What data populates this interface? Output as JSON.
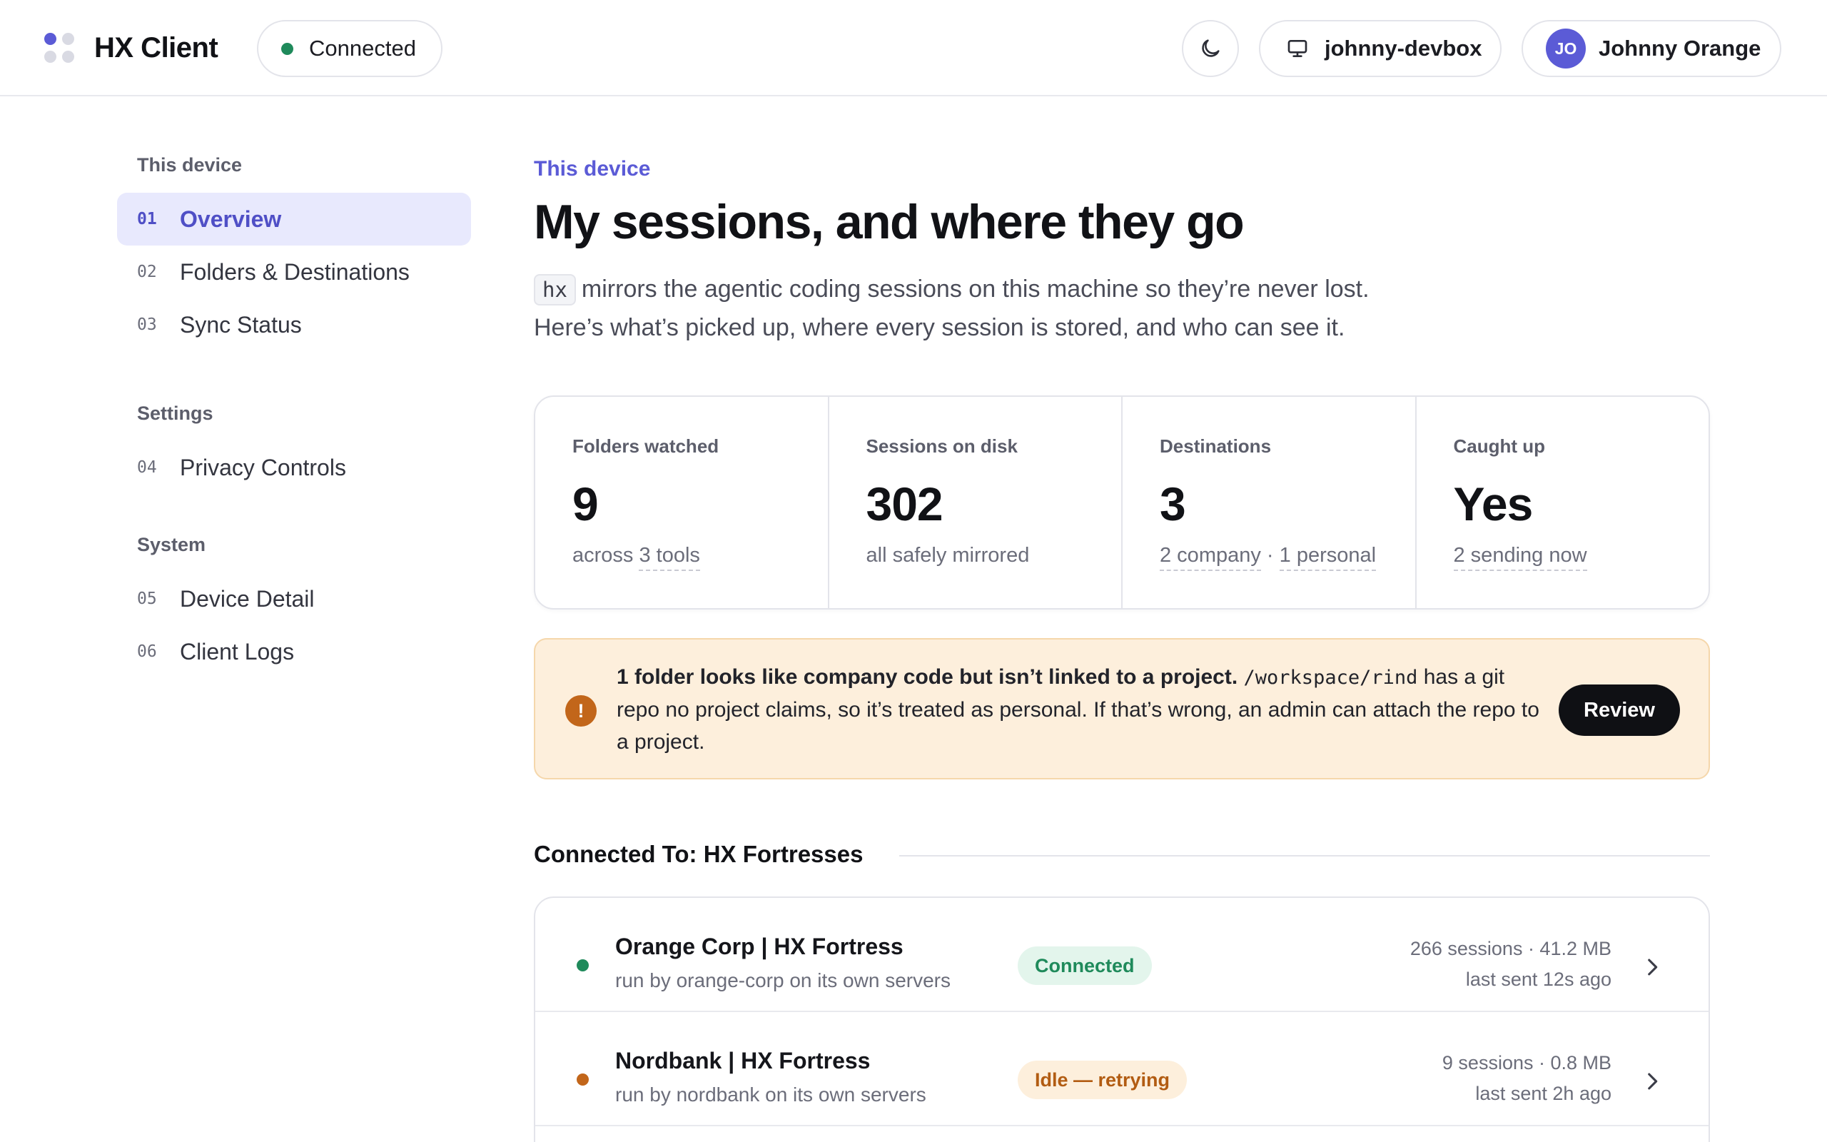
{
  "app": {
    "title": "HX Client",
    "status": "Connected",
    "device": "johnny-devbox",
    "user_initials": "JO",
    "user_name": "Johnny Orange"
  },
  "sidebar": {
    "groups": [
      {
        "label": "This device",
        "items": [
          {
            "num": "01",
            "label": "Overview"
          },
          {
            "num": "02",
            "label": "Folders & Destinations"
          },
          {
            "num": "03",
            "label": "Sync Status"
          }
        ]
      },
      {
        "label": "Settings",
        "items": [
          {
            "num": "04",
            "label": "Privacy Controls"
          }
        ]
      },
      {
        "label": "System",
        "items": [
          {
            "num": "05",
            "label": "Device Detail"
          },
          {
            "num": "06",
            "label": "Client Logs"
          }
        ]
      }
    ]
  },
  "main": {
    "eyebrow": "This device",
    "title": "My sessions, and where they go",
    "intro_code": "hx",
    "intro_line1": "mirrors the agentic coding sessions on this machine so they’re never lost.",
    "intro_line2": "Here’s what’s picked up, where every session is stored, and who can see it.",
    "stats": [
      {
        "label": "Folders watched",
        "value": "9",
        "sub_prefix": "across ",
        "sub_a": "3 tools",
        "sub_sep": "",
        "sub_b": ""
      },
      {
        "label": "Sessions on disk",
        "value": "302",
        "sub_prefix": "all safely mirrored",
        "sub_a": "",
        "sub_sep": "",
        "sub_b": ""
      },
      {
        "label": "Destinations",
        "value": "3",
        "sub_prefix": "",
        "sub_a": "2 company",
        "sub_sep": " · ",
        "sub_b": "1 personal"
      },
      {
        "label": "Caught up",
        "value": "Yes",
        "sub_prefix": "",
        "sub_a": "2 sending now",
        "sub_sep": "",
        "sub_b": ""
      }
    ],
    "alert": {
      "bold": "1 folder looks like company code but isn’t linked to a project.",
      "path": "/workspace/rind",
      "rest": "has a git repo no project claims, so it’s treated as personal. If that’s wrong, an admin can attach the repo to a project.",
      "button": "Review",
      "icon": "!"
    },
    "section_title": "Connected To: HX Fortresses",
    "destinations": [
      {
        "name": "Orange Corp | HX Fortress",
        "runby": "run by orange-corp on its own servers",
        "status": "Connected",
        "status_kind": "ok",
        "dot_color": "#1f8a5b",
        "meta1": "266 sessions · 41.2 MB",
        "meta2": "last sent 12s ago"
      },
      {
        "name": "Nordbank | HX Fortress",
        "runby": "run by nordbank on its own servers",
        "status": "Idle — retrying",
        "status_kind": "warn",
        "dot_color": "#c2661a",
        "meta1": "9 sessions · 0.8 MB",
        "meta2": "last sent 2h ago"
      }
    ]
  }
}
